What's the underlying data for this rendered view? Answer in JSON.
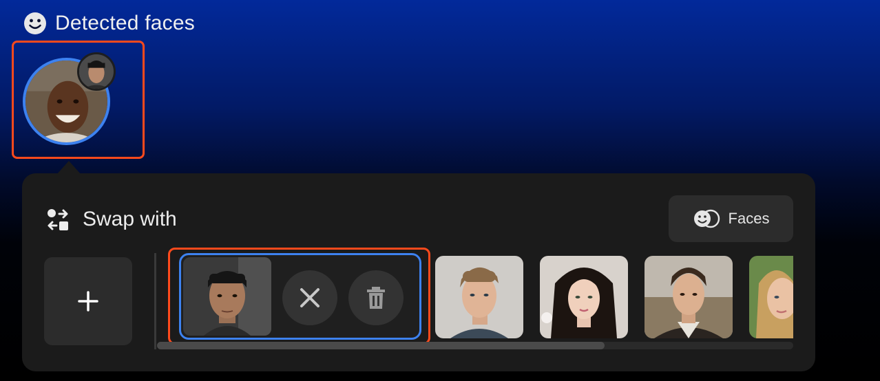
{
  "header": {
    "title": "Detected faces",
    "icon": "smiley-face-icon"
  },
  "detected_faces": {
    "items": [
      {
        "name": "detected-face-1",
        "selected": true,
        "assigned_swap": "face-1"
      }
    ]
  },
  "swap_panel": {
    "title": "Swap with",
    "icon": "swap-arrows-icon",
    "faces_button_label": "Faces",
    "faces_button_icon": "faces-icon",
    "add_button_icon": "plus-icon",
    "selected_actions": [
      "close-icon",
      "trash-icon"
    ],
    "faces": [
      {
        "name": "face-1",
        "selected": true
      },
      {
        "name": "face-2",
        "selected": false
      },
      {
        "name": "face-3",
        "selected": false
      },
      {
        "name": "face-4",
        "selected": false
      },
      {
        "name": "face-5",
        "selected": false
      }
    ],
    "scroll_position": 0
  },
  "colors": {
    "accent_blue": "#3d82f0",
    "highlight_red": "#ff4a1c",
    "panel_bg": "#1b1b1b",
    "button_bg": "#2c2c2c"
  }
}
